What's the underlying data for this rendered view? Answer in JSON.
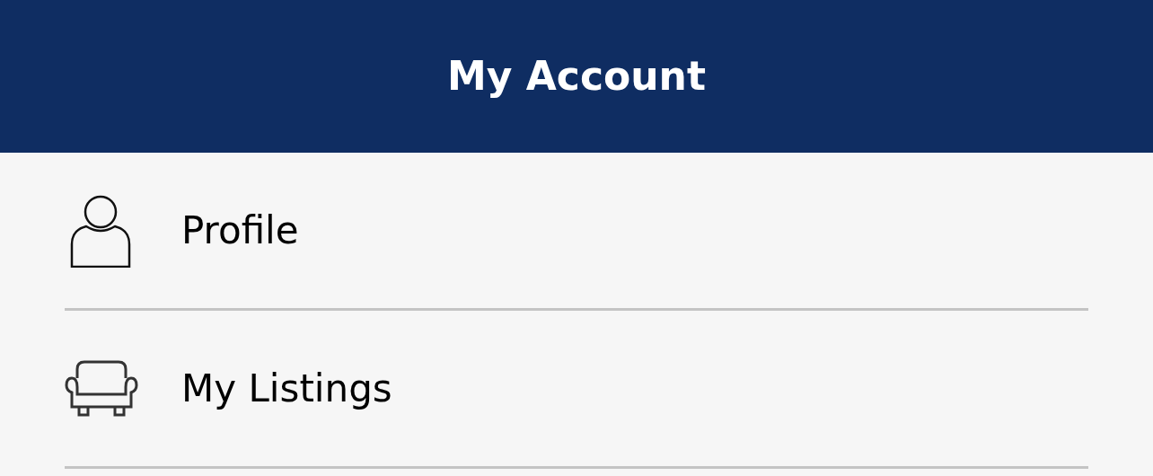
{
  "header": {
    "title": "My Account"
  },
  "menu": [
    {
      "label": "Profile",
      "kind": "profile"
    },
    {
      "label": "My Listings",
      "kind": "listings"
    }
  ]
}
